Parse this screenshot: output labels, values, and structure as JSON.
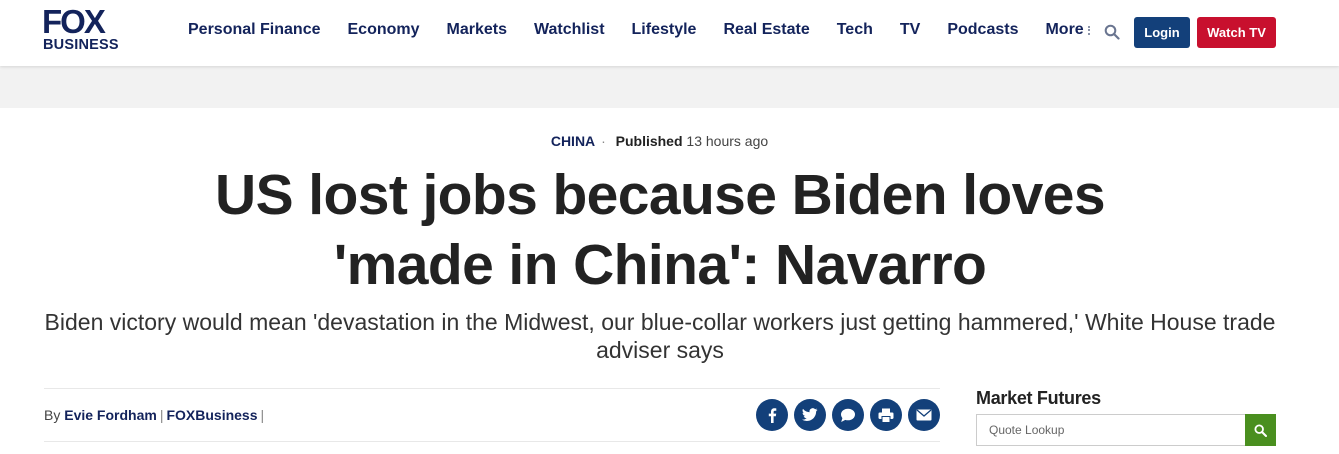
{
  "header": {
    "logo_top": "FOX",
    "logo_bottom": "BUSINESS",
    "nav": [
      "Personal Finance",
      "Economy",
      "Markets",
      "Watchlist",
      "Lifestyle",
      "Real Estate",
      "Tech",
      "TV",
      "Podcasts"
    ],
    "more_label": "More",
    "login_label": "Login",
    "watch_label": "Watch TV"
  },
  "article": {
    "category": "CHINA",
    "category_sep": "·",
    "published_label": "Published",
    "published_time": "13 hours ago",
    "headline_line1": "US lost jobs because Biden loves",
    "headline_line2": "'made in China': Navarro",
    "subhead": "Biden victory would mean 'devastation in the Midwest, our blue-collar workers just getting hammered,' White House trade adviser says",
    "byline_prefix": "By",
    "author": "Evie Fordham",
    "outlet": "FOXBusiness",
    "share_icons": [
      "facebook-icon",
      "twitter-icon",
      "comment-icon",
      "print-icon",
      "email-icon"
    ]
  },
  "sidebar": {
    "market_futures_title": "Market Futures",
    "quote_placeholder": "Quote Lookup"
  },
  "colors": {
    "navy": "#13235b",
    "button_blue": "#13407a",
    "watch_red": "#c8102e",
    "search_green": "#4a8f1f"
  }
}
